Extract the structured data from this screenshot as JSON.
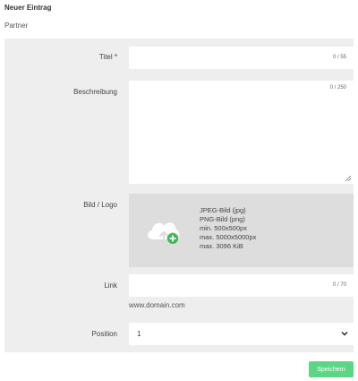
{
  "header": {
    "title": "Neuer Eintrag",
    "subtitle": "Partner"
  },
  "form": {
    "title": {
      "label": "Titel *",
      "value": "",
      "counter": "0 / 55"
    },
    "description": {
      "label": "Beschreibung",
      "value": "",
      "counter": "0 / 250"
    },
    "image": {
      "label": "Bild / Logo",
      "icon": "cloud-upload-add-icon",
      "requirements": [
        "JPEG-Bild (jpg)",
        "PNG-Bild (png)",
        "min. 500x500px",
        "max. 5000x5000px",
        "max. 3096 KiB"
      ]
    },
    "link": {
      "label": "Link",
      "value": "",
      "counter": "0 / 70",
      "hint": "www.domain.com"
    },
    "position": {
      "label": "Position",
      "selected": "1"
    }
  },
  "actions": {
    "save_label": "Speichern"
  },
  "colors": {
    "panel_bg": "#eeeeee",
    "upload_bg": "#dddddd",
    "save_button": "#5cd685"
  }
}
